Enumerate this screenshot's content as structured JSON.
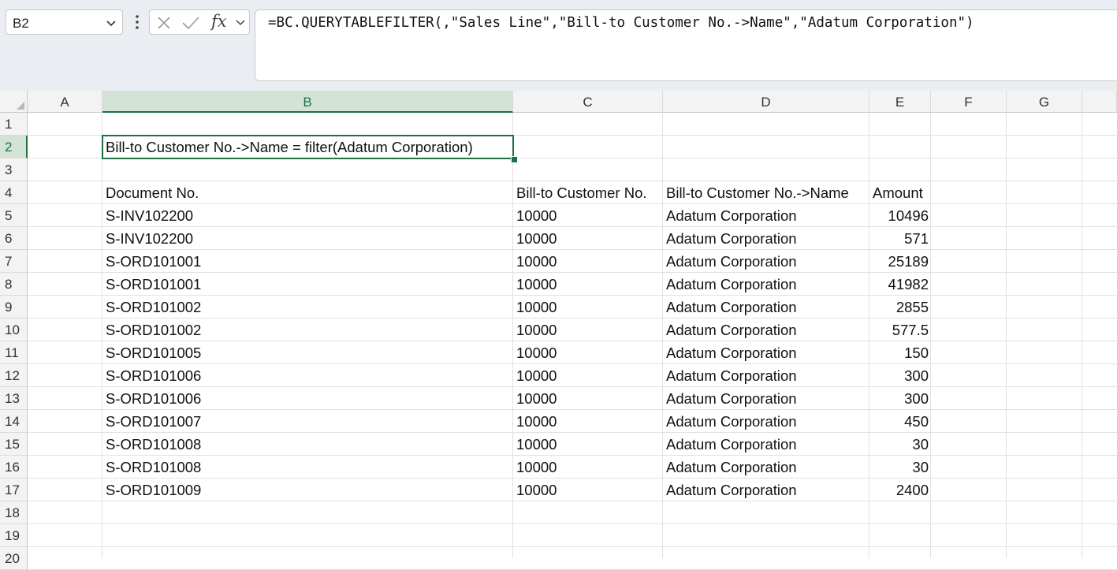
{
  "name_box": {
    "value": "B2"
  },
  "formula_bar": {
    "fx_label": "fx",
    "formula": "=BC.QUERYTABLEFILTER(,\"Sales Line\",\"Bill-to Customer No.->Name\",\"Adatum Corporation\")"
  },
  "columns": [
    "A",
    "B",
    "C",
    "D",
    "E",
    "F",
    "G"
  ],
  "rows": [
    "1",
    "2",
    "3",
    "4",
    "5",
    "6",
    "7",
    "8",
    "9",
    "10",
    "11",
    "12",
    "13",
    "14",
    "15",
    "16",
    "17",
    "18",
    "19",
    "20"
  ],
  "selected": {
    "column": "B",
    "row": "2"
  },
  "sheet": {
    "filter_label": "Bill-to Customer No.->Name = filter(Adatum Corporation)",
    "headers": [
      "Document No.",
      "Bill-to Customer No.",
      "Bill-to Customer No.->Name",
      "Amount"
    ],
    "records": [
      {
        "doc": "S-INV102200",
        "cust": "10000",
        "name": "Adatum Corporation",
        "amount": "10496"
      },
      {
        "doc": "S-INV102200",
        "cust": "10000",
        "name": "Adatum Corporation",
        "amount": "571"
      },
      {
        "doc": "S-ORD101001",
        "cust": "10000",
        "name": "Adatum Corporation",
        "amount": "25189"
      },
      {
        "doc": "S-ORD101001",
        "cust": "10000",
        "name": "Adatum Corporation",
        "amount": "41982"
      },
      {
        "doc": "S-ORD101002",
        "cust": "10000",
        "name": "Adatum Corporation",
        "amount": "2855"
      },
      {
        "doc": "S-ORD101002",
        "cust": "10000",
        "name": "Adatum Corporation",
        "amount": "577.5"
      },
      {
        "doc": "S-ORD101005",
        "cust": "10000",
        "name": "Adatum Corporation",
        "amount": "150"
      },
      {
        "doc": "S-ORD101006",
        "cust": "10000",
        "name": "Adatum Corporation",
        "amount": "300"
      },
      {
        "doc": "S-ORD101006",
        "cust": "10000",
        "name": "Adatum Corporation",
        "amount": "300"
      },
      {
        "doc": "S-ORD101007",
        "cust": "10000",
        "name": "Adatum Corporation",
        "amount": "450"
      },
      {
        "doc": "S-ORD101008",
        "cust": "10000",
        "name": "Adatum Corporation",
        "amount": "30"
      },
      {
        "doc": "S-ORD101008",
        "cust": "10000",
        "name": "Adatum Corporation",
        "amount": "30"
      },
      {
        "doc": "S-ORD101009",
        "cust": "10000",
        "name": "Adatum Corporation",
        "amount": "2400"
      }
    ]
  },
  "colors": {
    "accent": "#1e7145",
    "header_bg": "#f3f3f3",
    "selected_header_bg": "#d3e3d5",
    "toolbar_bg": "#eaeef2"
  }
}
